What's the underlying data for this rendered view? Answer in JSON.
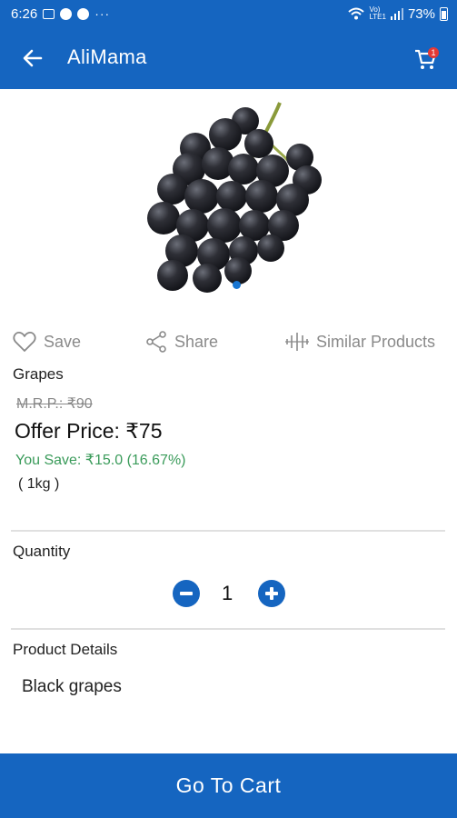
{
  "status_bar": {
    "time": "6:26",
    "network_label_top": "Vo)",
    "network_label_bottom": "LTE1",
    "battery": "73%"
  },
  "app_bar": {
    "title": "AliMama",
    "cart_badge": "1",
    "back_icon": "arrow-left-icon",
    "cart_icon": "shopping-cart-icon"
  },
  "actions": {
    "save_label": "Save",
    "share_label": "Share",
    "similar_label": "Similar Products"
  },
  "product": {
    "name": "Grapes",
    "mrp": "M.R.P.: ₹90",
    "offer_price": "Offer Price: ₹75",
    "you_save": "You Save: ₹15.0 (16.67%)",
    "unit": "( 1kg )"
  },
  "quantity": {
    "label": "Quantity",
    "value": "1"
  },
  "details": {
    "label": "Product Details",
    "text": "Black grapes"
  },
  "cta": {
    "label": "Go To Cart"
  },
  "colors": {
    "primary": "#1565c0",
    "save_green": "#3a9b5a",
    "indicator": "#1976d2"
  }
}
